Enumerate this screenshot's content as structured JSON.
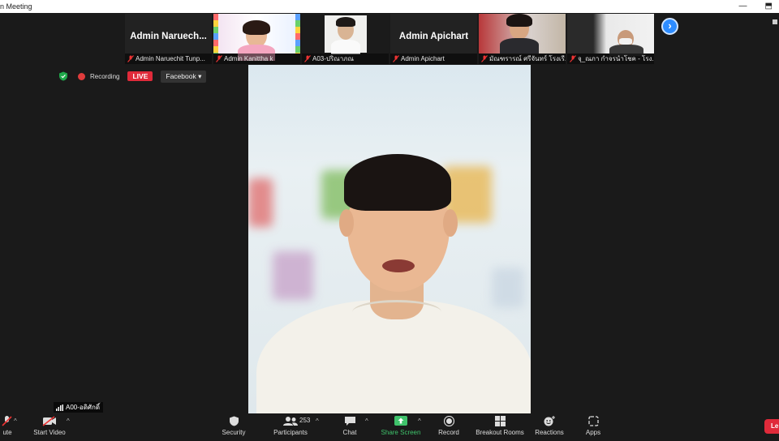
{
  "window": {
    "title": "n Meeting",
    "controls": [
      "—",
      "⬒"
    ]
  },
  "participants": [
    {
      "display": "Admin  Naruech...",
      "label": "Admin Naruechit Tunp..."
    },
    {
      "display": "",
      "label": "Admin Kanittha k"
    },
    {
      "display": "",
      "label": "A03-ปริณาภณ"
    },
    {
      "display": "Admin Apichart",
      "label": "Admin Apichart"
    },
    {
      "display": "",
      "label": "มัณฑรารณ์ ศรีจันทร์ โรงเรี..."
    },
    {
      "display": "",
      "label": "จุ_ณภา กำจรนำโชค - โรง..."
    }
  ],
  "status": {
    "recording": "Recording",
    "live": "LIVE",
    "stream_target": "Facebook"
  },
  "speaker": {
    "name": "A00-อดิศักดิ์"
  },
  "toolbar": {
    "mute": "ute",
    "start_video": "Start Video",
    "security": "Security",
    "participants": "Participants",
    "participants_count": "253",
    "chat": "Chat",
    "share_screen": "Share Screen",
    "record": "Record",
    "breakout_rooms": "Breakout Rooms",
    "reactions": "Reactions",
    "apps": "Apps",
    "leave": "Le"
  },
  "colors": {
    "accent": "#2d8cff",
    "live": "#e02a3a",
    "share": "#3fc26b",
    "background": "#1a1a1a"
  }
}
